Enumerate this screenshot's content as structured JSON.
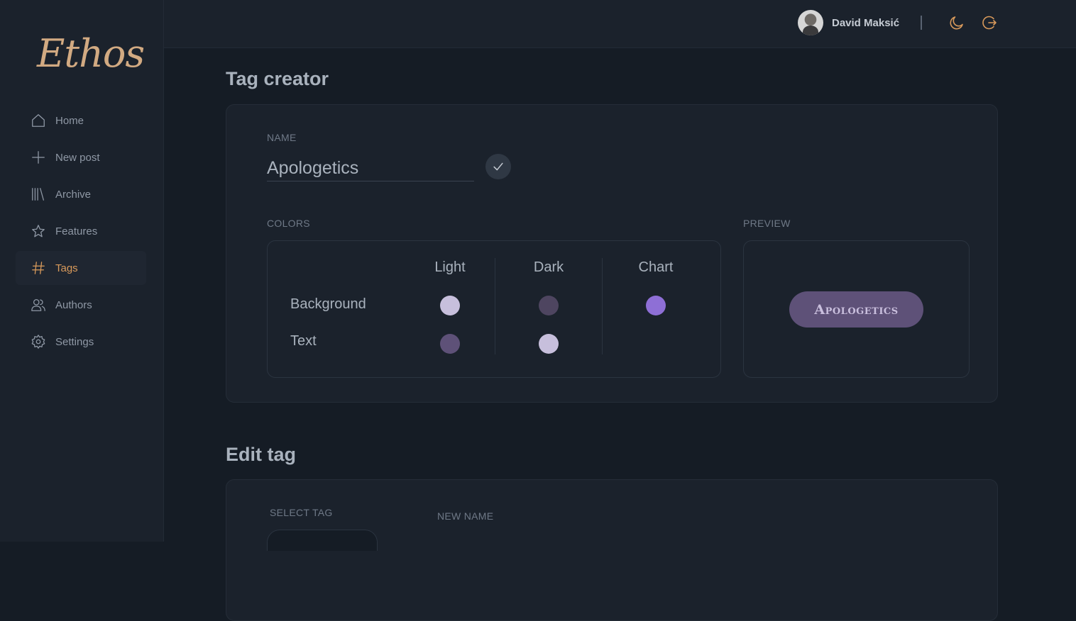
{
  "brand": {
    "logo": "Ethos"
  },
  "sidebar": {
    "items": [
      {
        "label": "Home",
        "icon": "home-icon"
      },
      {
        "label": "New post",
        "icon": "plus-icon"
      },
      {
        "label": "Archive",
        "icon": "library-icon"
      },
      {
        "label": "Features",
        "icon": "star-icon"
      },
      {
        "label": "Tags",
        "icon": "hash-icon",
        "active": true
      },
      {
        "label": "Authors",
        "icon": "users-icon"
      },
      {
        "label": "Settings",
        "icon": "gear-icon"
      }
    ]
  },
  "header": {
    "user_name": "David Maksić",
    "icons": [
      "moon-icon",
      "logout-icon"
    ]
  },
  "tag_creator": {
    "title": "Tag creator",
    "name_label": "NAME",
    "name_value": "Apologetics",
    "colors_label": "COLORS",
    "preview_label": "PREVIEW",
    "columns": [
      "Light",
      "Dark",
      "Chart"
    ],
    "rows": [
      "Background",
      "Text"
    ],
    "swatches": {
      "background_light": "#c7bfdc",
      "background_dark": "#4e4560",
      "background_chart": "#8e6fd6",
      "text_light": "#5e5178",
      "text_dark": "#c7bfdc"
    },
    "preview_text": "Apologetics"
  },
  "edit_tag": {
    "title": "Edit tag",
    "select_label": "SELECT TAG",
    "new_name_label": "NEW NAME"
  },
  "colors": {
    "accent": "#d99a5b",
    "background": "#151c25",
    "panel": "#1b222c"
  }
}
